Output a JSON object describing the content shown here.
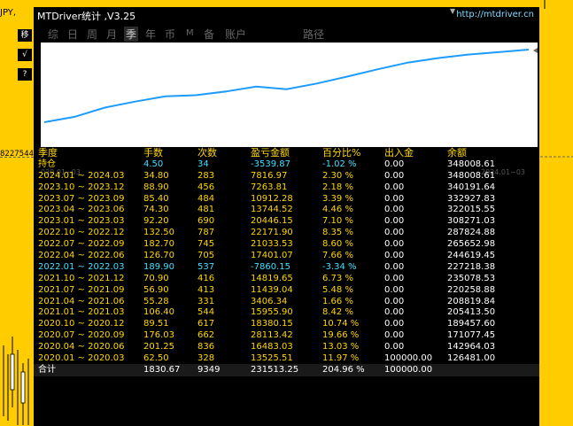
{
  "background": {
    "pair_label": "JPY,",
    "price_tag": "8227544",
    "side_buttons": [
      "移",
      "√",
      "?"
    ]
  },
  "window": {
    "title": "MTDriver统计 ,V3.25",
    "url": "http://mtdriver.cn"
  },
  "tabs": [
    {
      "label": "综",
      "active": false
    },
    {
      "label": "日",
      "active": false
    },
    {
      "label": "周",
      "active": false
    },
    {
      "label": "月",
      "active": false
    },
    {
      "label": "季",
      "active": true
    },
    {
      "label": "年",
      "active": false
    },
    {
      "label": "币",
      "active": false
    },
    {
      "label": "M",
      "active": false
    },
    {
      "label": "备",
      "active": false
    },
    {
      "label": "账户",
      "active": false
    },
    {
      "label": "路径",
      "active": false
    }
  ],
  "chart_data": {
    "type": "line",
    "x_start_label": "020.01~03",
    "x_end_label": "2024.01~03",
    "series": [
      {
        "color": "#1E9BFF",
        "x": [
          "2020.01~2020.03",
          "2020.04~2020.06",
          "2020.07~2020.09",
          "2020.10~2020.12",
          "2021.01~2021.03",
          "2021.04~2021.06",
          "2021.07~2021.09",
          "2021.10~2021.12",
          "2022.01~2022.03",
          "2022.04~2022.06",
          "2022.07~2022.09",
          "2022.10~2022.12",
          "2023.01~2023.03",
          "2023.04~2023.06",
          "2023.07~2023.09",
          "2023.10~2023.12",
          "2024.01~2024.03"
        ],
        "values": [
          126481.0,
          142964.03,
          171077.45,
          189457.6,
          205413.5,
          208819.84,
          220258.88,
          235078.53,
          227218.38,
          244619.45,
          265652.98,
          287824.88,
          308271.03,
          322015.55,
          332927.83,
          340191.64,
          348008.61
        ]
      }
    ]
  },
  "table": {
    "headers": {
      "season": "季度",
      "hands": "手数",
      "count": "次数",
      "pl": "盈亏金额",
      "pct": "百分比%",
      "io": "出入金",
      "bal": "余额"
    },
    "rows": [
      {
        "season": "持仓",
        "hands": "4.50",
        "count": "34",
        "pl": "-3539.87",
        "pct": "-1.02 %",
        "io": "0.00",
        "bal": "348008.61",
        "style": "hold"
      },
      {
        "season": "2024.01 ~ 2024.03",
        "hands": "34.80",
        "count": "283",
        "pl": "7816.97",
        "pct": "2.30 %",
        "io": "0.00",
        "bal": "348008.61",
        "style": ""
      },
      {
        "season": "2023.10 ~ 2023.12",
        "hands": "88.90",
        "count": "456",
        "pl": "7263.81",
        "pct": "2.18 %",
        "io": "0.00",
        "bal": "340191.64",
        "style": ""
      },
      {
        "season": "2023.07 ~ 2023.09",
        "hands": "85.40",
        "count": "484",
        "pl": "10912.28",
        "pct": "3.39 %",
        "io": "0.00",
        "bal": "332927.83",
        "style": ""
      },
      {
        "season": "2023.04 ~ 2023.06",
        "hands": "74.30",
        "count": "481",
        "pl": "13744.52",
        "pct": "4.46 %",
        "io": "0.00",
        "bal": "322015.55",
        "style": ""
      },
      {
        "season": "2023.01 ~ 2023.03",
        "hands": "92.20",
        "count": "690",
        "pl": "20446.15",
        "pct": "7.10 %",
        "io": "0.00",
        "bal": "308271.03",
        "style": ""
      },
      {
        "season": "2022.10 ~ 2022.12",
        "hands": "132.50",
        "count": "787",
        "pl": "22171.90",
        "pct": "8.35 %",
        "io": "0.00",
        "bal": "287824.88",
        "style": ""
      },
      {
        "season": "2022.07 ~ 2022.09",
        "hands": "182.70",
        "count": "745",
        "pl": "21033.53",
        "pct": "8.60 %",
        "io": "0.00",
        "bal": "265652.98",
        "style": ""
      },
      {
        "season": "2022.04 ~ 2022.06",
        "hands": "126.70",
        "count": "705",
        "pl": "17401.07",
        "pct": "7.66 %",
        "io": "0.00",
        "bal": "244619.45",
        "style": ""
      },
      {
        "season": "2022.01 ~ 2022.03",
        "hands": "189.90",
        "count": "537",
        "pl": "-7860.15",
        "pct": "-3.34 %",
        "io": "0.00",
        "bal": "227218.38",
        "style": "blue"
      },
      {
        "season": "2021.10 ~ 2021.12",
        "hands": "70.90",
        "count": "416",
        "pl": "14819.65",
        "pct": "6.73 %",
        "io": "0.00",
        "bal": "235078.53",
        "style": ""
      },
      {
        "season": "2021.07 ~ 2021.09",
        "hands": "56.90",
        "count": "413",
        "pl": "11439.04",
        "pct": "5.48 %",
        "io": "0.00",
        "bal": "220258.88",
        "style": ""
      },
      {
        "season": "2021.04 ~ 2021.06",
        "hands": "55.28",
        "count": "331",
        "pl": "3406.34",
        "pct": "1.66 %",
        "io": "0.00",
        "bal": "208819.84",
        "style": ""
      },
      {
        "season": "2021.01 ~ 2021.03",
        "hands": "106.40",
        "count": "544",
        "pl": "15955.90",
        "pct": "8.42 %",
        "io": "0.00",
        "bal": "205413.50",
        "style": ""
      },
      {
        "season": "2020.10 ~ 2020.12",
        "hands": "89.51",
        "count": "617",
        "pl": "18380.15",
        "pct": "10.74 %",
        "io": "0.00",
        "bal": "189457.60",
        "style": ""
      },
      {
        "season": "2020.07 ~ 2020.09",
        "hands": "176.03",
        "count": "662",
        "pl": "28113.42",
        "pct": "19.66 %",
        "io": "0.00",
        "bal": "171077.45",
        "style": ""
      },
      {
        "season": "2020.04 ~ 2020.06",
        "hands": "201.25",
        "count": "836",
        "pl": "16483.03",
        "pct": "13.03 %",
        "io": "0.00",
        "bal": "142964.03",
        "style": ""
      },
      {
        "season": "2020.01 ~ 2020.03",
        "hands": "62.50",
        "count": "328",
        "pl": "13525.51",
        "pct": "11.97 %",
        "io": "100000.00",
        "bal": "126481.00",
        "style": ""
      }
    ],
    "total": {
      "season": "合计",
      "hands": "1830.67",
      "count": "9349",
      "pl": "231513.25",
      "pct": "204.96 %",
      "io": "100000.00",
      "bal": ""
    }
  }
}
